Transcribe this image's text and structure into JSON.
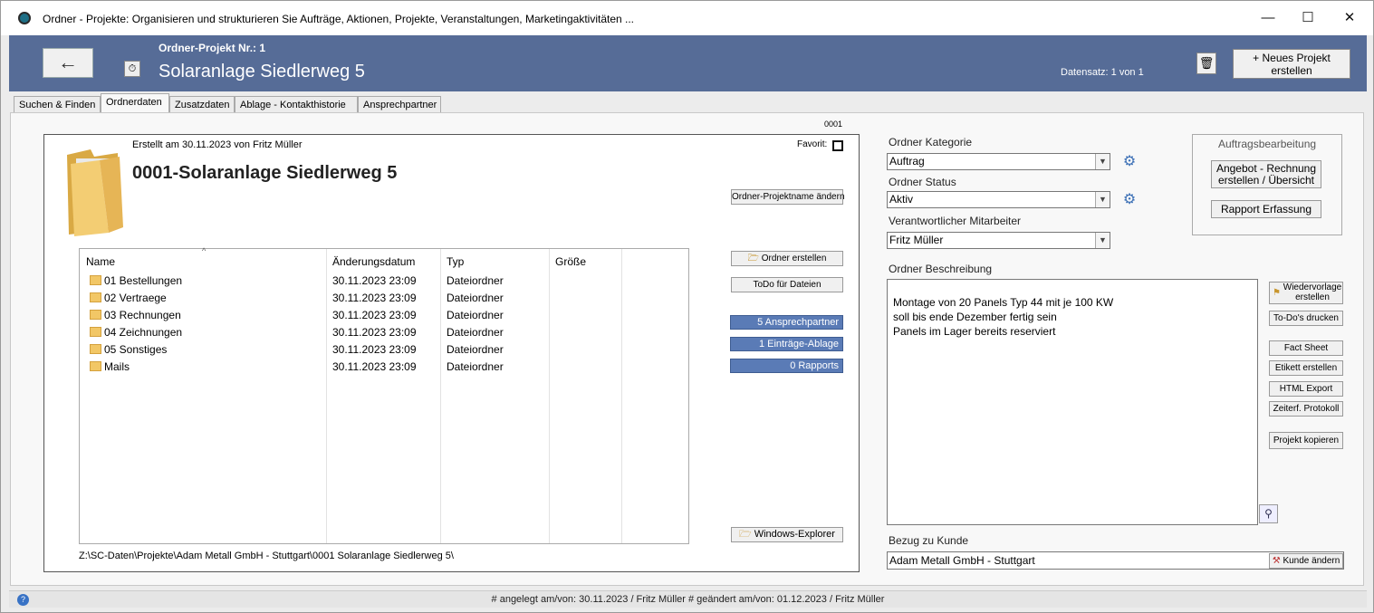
{
  "window": {
    "title": "Ordner - Projekte: Organisieren und strukturieren Sie Aufträge, Aktionen, Projekte, Veranstaltungen, Marketingaktivitäten ..."
  },
  "header": {
    "project_nr_label": "Ordner-Projekt Nr.: 1",
    "project_title": "Solaranlage Siedlerweg 5",
    "datensatz": "Datensatz: 1 von 1",
    "new_project_label_line1": "+ Neues Projekt",
    "new_project_label_line2": "erstellen"
  },
  "tabs": [
    "Suchen & Finden",
    "Ordnerdaten",
    "Zusatzdaten",
    "Ablage - Kontakthistorie",
    "Ansprechpartner"
  ],
  "panel": {
    "nr_small": "0001",
    "created": "Erstellt am 30.11.2023 von Fritz Müller",
    "folder_title": "0001-Solaranlage Siedlerweg 5",
    "favorit_label": "Favorit:",
    "rename_button": "Ordner-Projektname ändern",
    "create_folder_button": "Ordner erstellen",
    "todo_files_button": "ToDo für Dateien",
    "ansprechpartner_button": "5 Ansprechpartner",
    "eintraege_button": "1 Einträge-Ablage",
    "rapports_button": "0 Rapports",
    "explorer_button": "Windows-Explorer",
    "path": "Z:\\SC-Daten\\Projekte\\Adam Metall GmbH - Stuttgart\\0001 Solaranlage Siedlerweg 5\\"
  },
  "file_list": {
    "columns": [
      "Name",
      "Änderungsdatum",
      "Typ",
      "Größe"
    ],
    "rows": [
      {
        "name": "01 Bestellungen",
        "date": "30.11.2023 23:09",
        "type": "Dateiordner"
      },
      {
        "name": "02 Vertraege",
        "date": "30.11.2023 23:09",
        "type": "Dateiordner"
      },
      {
        "name": "03 Rechnungen",
        "date": "30.11.2023 23:09",
        "type": "Dateiordner"
      },
      {
        "name": "04 Zeichnungen",
        "date": "30.11.2023 23:09",
        "type": "Dateiordner"
      },
      {
        "name": "05 Sonstiges",
        "date": "30.11.2023 23:09",
        "type": "Dateiordner"
      },
      {
        "name": "Mails",
        "date": "30.11.2023 23:09",
        "type": "Dateiordner"
      }
    ]
  },
  "right": {
    "kategorie_label": "Ordner Kategorie",
    "kategorie_value": "Auftrag",
    "status_label": "Ordner Status",
    "status_value": "Aktiv",
    "mitarbeiter_label": "Verantwortlicher Mitarbeiter",
    "mitarbeiter_value": "Fritz Müller",
    "beschreibung_label": "Ordner Beschreibung",
    "beschreibung_lines": [
      "Montage von 20 Panels Typ 44 mit je 100 KW",
      "soll bis ende Dezember fertig sein",
      "Panels im Lager bereits reserviert"
    ],
    "kunde_label": "Bezug zu Kunde",
    "kunde_value": "Adam Metall GmbH - Stuttgart",
    "kunde_button": "Kunde ändern"
  },
  "auftragsbearbeitung": {
    "title": "Auftragsbearbeitung",
    "angebot_line1": "Angebot - Rechnung",
    "angebot_line2": "erstellen / Übersicht",
    "rapport": "Rapport Erfassung"
  },
  "side_buttons": {
    "wiedervorlage_line1": "Wiedervorlage",
    "wiedervorlage_line2": "erstellen",
    "todos_drucken": "To-Do's drucken",
    "fact_sheet": "Fact Sheet",
    "etikett": "Etikett erstellen",
    "html_export": "HTML Export",
    "zeiterf": "Zeiterf. Protokoll",
    "kopieren": "Projekt kopieren"
  },
  "status_bar": "# angelegt am/von: 30.11.2023 / Fritz Müller # geändert am/von: 01.12.2023 / Fritz Müller",
  "icons": [
    "app-icon",
    "minimize-icon",
    "maximize-icon",
    "close-icon",
    "back-arrow-icon",
    "timer-icon",
    "trash-icon",
    "folder-icon",
    "gear-icon",
    "zoom-icon",
    "help-icon"
  ]
}
